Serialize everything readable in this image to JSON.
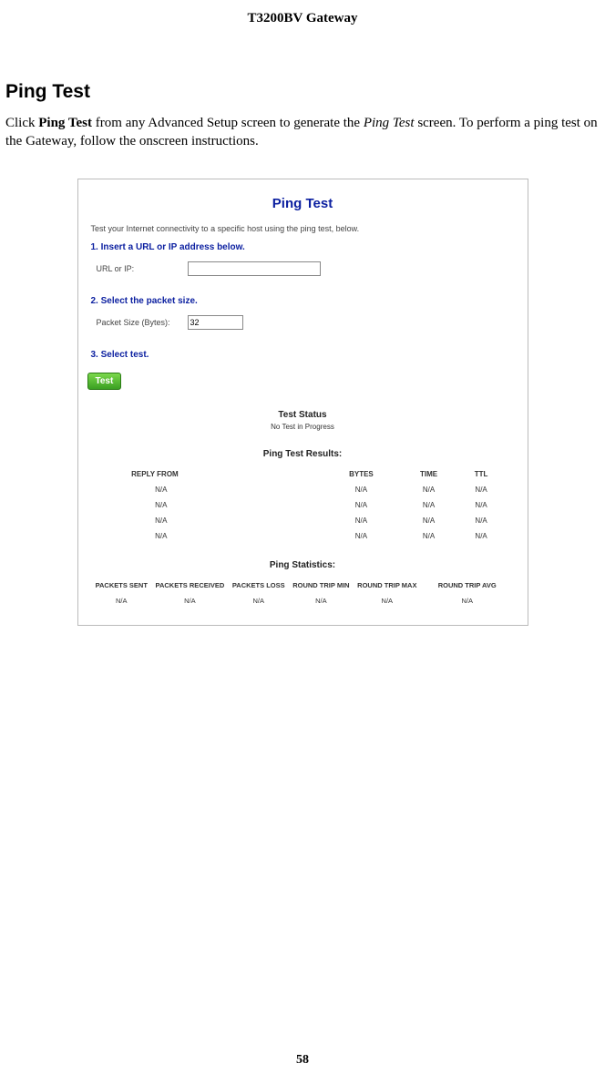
{
  "header": {
    "title": "T3200BV Gateway"
  },
  "section": {
    "title": "Ping Test"
  },
  "body": {
    "pre": "Click ",
    "bold1": "Ping Test",
    "mid": " from any Advanced Setup screen to generate the ",
    "ital1": "Ping Test",
    "post": " screen. To perform a ping test on the Gateway, follow the onscreen instructions."
  },
  "screenshot": {
    "title": "Ping Test",
    "subtitle": "Test your Internet connectivity to a specific host using the ping test, below.",
    "step1": "1. Insert a URL or IP address below.",
    "url_label": "URL or IP:",
    "url_value": "",
    "step2": "2. Select the packet size.",
    "pkt_label": "Packet Size (Bytes):",
    "pkt_value": "32",
    "step3": "3. Select test.",
    "test_btn": "Test",
    "status_head": "Test Status",
    "status_text": "No Test in Progress",
    "results_head": "Ping Test Results:",
    "results_cols": {
      "reply": "REPLY FROM",
      "bytes": "BYTES",
      "time": "TIME",
      "ttl": "TTL"
    },
    "results_rows": [
      {
        "reply": "N/A",
        "bytes": "N/A",
        "time": "N/A",
        "ttl": "N/A"
      },
      {
        "reply": "N/A",
        "bytes": "N/A",
        "time": "N/A",
        "ttl": "N/A"
      },
      {
        "reply": "N/A",
        "bytes": "N/A",
        "time": "N/A",
        "ttl": "N/A"
      },
      {
        "reply": "N/A",
        "bytes": "N/A",
        "time": "N/A",
        "ttl": "N/A"
      }
    ],
    "stats_head": "Ping Statistics:",
    "stats_cols": {
      "sent": "PACKETS SENT",
      "recv": "PACKETS RECEIVED",
      "loss": "PACKETS LOSS",
      "rtmin": "ROUND TRIP MIN",
      "rtmax": "ROUND TRIP MAX",
      "rtavg": "ROUND TRIP AVG"
    },
    "stats_row": {
      "sent": "N/A",
      "recv": "N/A",
      "loss": "N/A",
      "rtmin": "N/A",
      "rtmax": "N/A",
      "rtavg": "N/A"
    }
  },
  "page_number": "58"
}
